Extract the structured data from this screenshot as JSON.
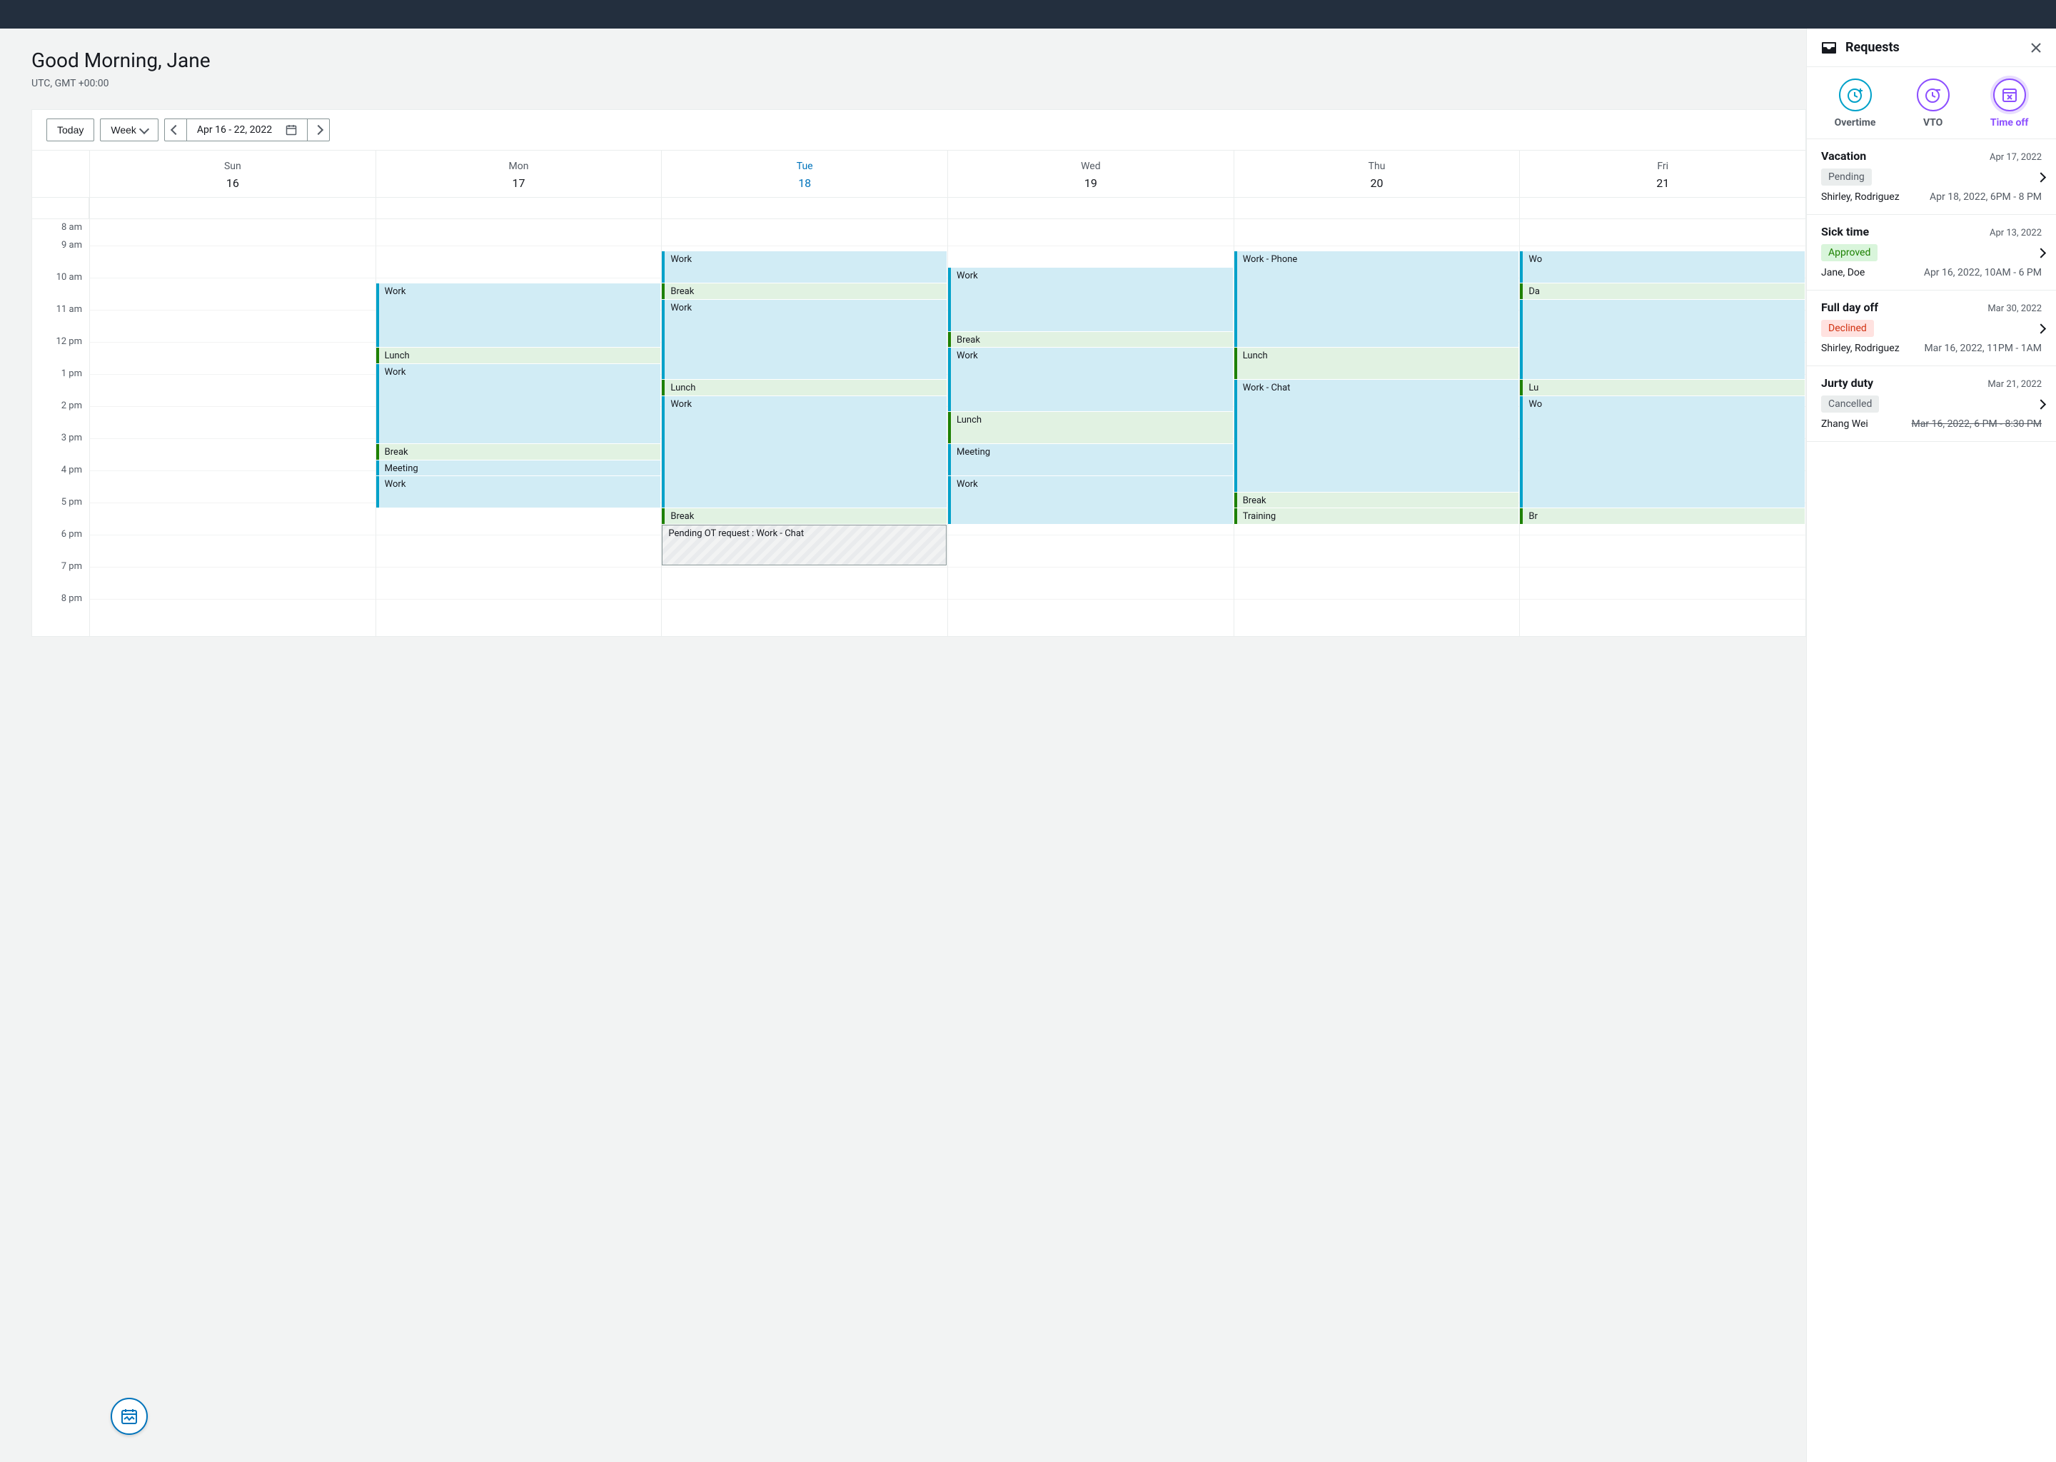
{
  "header": {
    "greeting": "Good Morning, Jane",
    "timezone": "UTC, GMT +00:00"
  },
  "toolbar": {
    "today": "Today",
    "view": "Week",
    "range": "Apr 16 - 22, 2022"
  },
  "days": [
    {
      "name": "Sun",
      "num": "16",
      "active": false
    },
    {
      "name": "Mon",
      "num": "17",
      "active": false
    },
    {
      "name": "Tue",
      "num": "18",
      "active": true
    },
    {
      "name": "Wed",
      "num": "19",
      "active": false
    },
    {
      "name": "Thu",
      "num": "20",
      "active": false
    },
    {
      "name": "Fri",
      "num": "21",
      "active": false
    }
  ],
  "hours": [
    "8 am",
    "9 am",
    "10 am",
    "11 am",
    "12 pm",
    "1 pm",
    "2 pm",
    "3 pm",
    "4 pm",
    "5 pm",
    "6 pm",
    "7 pm",
    "8 pm"
  ],
  "hourStart": 8,
  "hourHeight": 45,
  "events": {
    "mon": [
      {
        "label": "Work",
        "type": "work",
        "start": 10,
        "end": 12
      },
      {
        "label": "Lunch",
        "type": "break",
        "start": 12,
        "end": 12.5
      },
      {
        "label": "Work",
        "type": "work",
        "start": 12.5,
        "end": 15
      },
      {
        "label": "Break",
        "type": "break",
        "start": 15,
        "end": 15.5
      },
      {
        "label": "Meeting",
        "type": "work",
        "start": 15.5,
        "end": 16
      },
      {
        "label": "Work",
        "type": "work",
        "start": 16,
        "end": 17
      }
    ],
    "tue": [
      {
        "label": "Work",
        "type": "work",
        "start": 9,
        "end": 10
      },
      {
        "label": "Break",
        "type": "break",
        "start": 10,
        "end": 10.5
      },
      {
        "label": "Work",
        "type": "work",
        "start": 10.5,
        "end": 13
      },
      {
        "label": "Lunch",
        "type": "break",
        "start": 13,
        "end": 13.5
      },
      {
        "label": "Work",
        "type": "work",
        "start": 13.5,
        "end": 17
      },
      {
        "label": "Break",
        "type": "break",
        "start": 17,
        "end": 17.5
      },
      {
        "label": "Pending OT request : Work - Chat",
        "type": "pending",
        "start": 17.5,
        "end": 18.8
      }
    ],
    "wed": [
      {
        "label": "Work",
        "type": "work",
        "start": 9.5,
        "end": 11.5
      },
      {
        "label": "Break",
        "type": "break",
        "start": 11.5,
        "end": 12
      },
      {
        "label": "Work",
        "type": "work",
        "start": 12,
        "end": 14
      },
      {
        "label": "Lunch",
        "type": "break",
        "start": 14,
        "end": 15
      },
      {
        "label": "Meeting",
        "type": "work",
        "start": 15,
        "end": 16
      },
      {
        "label": "Work",
        "type": "work",
        "start": 16,
        "end": 17.5
      }
    ],
    "thu": [
      {
        "label": "Work - Phone",
        "type": "work",
        "start": 9,
        "end": 12
      },
      {
        "label": "Lunch",
        "type": "break",
        "start": 12,
        "end": 13
      },
      {
        "label": "Work - Chat",
        "type": "work",
        "start": 13,
        "end": 16.5
      },
      {
        "label": "Break",
        "type": "break",
        "start": 16.5,
        "end": 17
      },
      {
        "label": "Training",
        "type": "break",
        "start": 17,
        "end": 17.5
      }
    ],
    "fri": [
      {
        "label": "Wo",
        "type": "work",
        "start": 9,
        "end": 10
      },
      {
        "label": "Da",
        "type": "break",
        "start": 10,
        "end": 10.5
      },
      {
        "label": "",
        "type": "work",
        "start": 10.5,
        "end": 13
      },
      {
        "label": "Lu",
        "type": "break",
        "start": 13,
        "end": 13.5
      },
      {
        "label": "Wo",
        "type": "work",
        "start": 13.5,
        "end": 17
      },
      {
        "label": "Br",
        "type": "break",
        "start": 17,
        "end": 17.5
      }
    ]
  },
  "panel": {
    "title": "Requests",
    "tabs": [
      {
        "label": "Overtime",
        "color": "teal",
        "active": false,
        "icon": "clock-plus"
      },
      {
        "label": "VTO",
        "color": "purple",
        "active": false,
        "icon": "clock-minus"
      },
      {
        "label": "Time off",
        "color": "purple",
        "active": true,
        "icon": "cal-x"
      }
    ],
    "requests": [
      {
        "title": "Vacation",
        "date": "Apr 17, 2022",
        "status": "Pending",
        "statusClass": "pending",
        "person": "Shirley, Rodriguez",
        "time": "Apr 18, 2022, 6PM - 8 PM",
        "strike": false
      },
      {
        "title": "Sick time",
        "date": "Apr 13, 2022",
        "status": "Approved",
        "statusClass": "approved",
        "person": "Jane, Doe",
        "time": "Apr 16, 2022, 10AM - 6 PM",
        "strike": false
      },
      {
        "title": "Full day off",
        "date": "Mar 30, 2022",
        "status": "Declined",
        "statusClass": "declined",
        "person": "Shirley, Rodriguez",
        "time": "Mar 16, 2022, 11PM - 1AM",
        "strike": false
      },
      {
        "title": "Jurty duty",
        "date": "Mar 21, 2022",
        "status": "Cancelled",
        "statusClass": "cancelled",
        "person": "Zhang Wei",
        "time": "Mar 16, 2022, 6 PM - 8:30 PM",
        "strike": true
      }
    ]
  }
}
